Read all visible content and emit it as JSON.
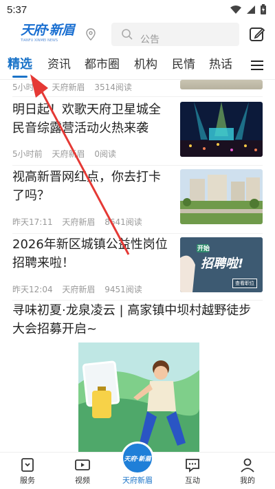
{
  "status_bar": {
    "time": "5:37"
  },
  "header": {
    "logo_text": "天府·新眉",
    "logo_sub": "TIANFU XINMEI NEWS",
    "search_placeholder": "公告"
  },
  "tabs": [
    {
      "label": "精选",
      "active": true
    },
    {
      "label": "资讯"
    },
    {
      "label": "都市圈"
    },
    {
      "label": "机构"
    },
    {
      "label": "民情"
    },
    {
      "label": "热话"
    }
  ],
  "feed": {
    "partial_item": {
      "time": "5小时前",
      "source": "天府新眉",
      "reads": "3514阅读"
    },
    "items": [
      {
        "title": "明日起！欢歌天府卫星城全民音综露营活动火热来袭",
        "time": "5小时前",
        "source": "天府新眉",
        "reads": "0阅读",
        "thumb": "concert-stage-image"
      },
      {
        "title": "视高新晋网红点，你去打卡了吗？",
        "time": "昨天17:11",
        "source": "天府新眉",
        "reads": "8641阅读",
        "thumb": "town-buildings-image"
      },
      {
        "title": "2026年新区城镇公益性岗位招聘来啦！",
        "time": "昨天12:04",
        "source": "天府新眉",
        "reads": "9451阅读",
        "thumb": "recruitment-banner-image",
        "thumb_text_1": "开始",
        "thumb_text_2": "招聘啦!",
        "thumb_text_3": "查看职位"
      }
    ],
    "big_item": {
      "title": "寻味初夏·龙泉凌云 | 高家镇中坝村越野徒步大会招募开启~"
    }
  },
  "bottom_nav": [
    {
      "label": "服务",
      "icon": "service-icon"
    },
    {
      "label": "视频",
      "icon": "video-icon"
    },
    {
      "label": "天府新眉",
      "icon": "home-logo-icon"
    },
    {
      "label": "互动",
      "icon": "chat-icon"
    },
    {
      "label": "我的",
      "icon": "profile-icon"
    }
  ],
  "colors": {
    "accent": "#1a73c8",
    "arrow": "#e53935"
  }
}
